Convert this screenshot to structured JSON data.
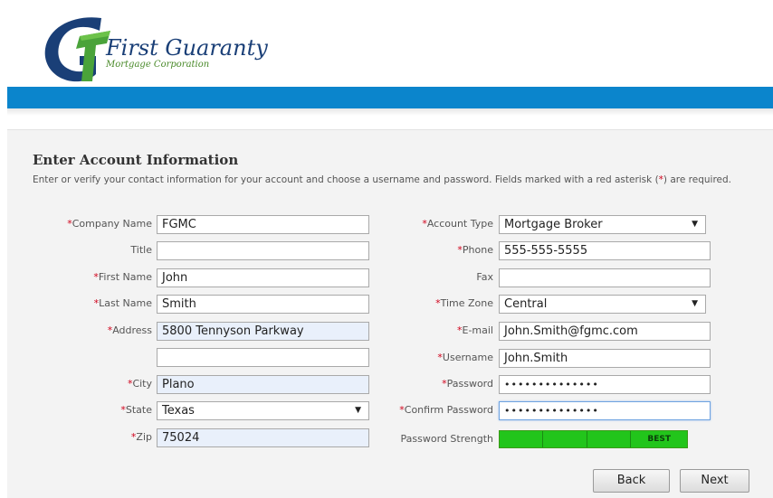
{
  "brand": {
    "name": "First Guaranty",
    "subtitle": "Mortgage Corporation",
    "colors": {
      "navy": "#1a3f77",
      "green": "#4a8a2a",
      "bar": "#0b85cc"
    }
  },
  "form": {
    "title": "Enter Account Information",
    "description_before": "Enter or verify your contact information for your account and choose a username and password. Fields marked with a red asterisk (",
    "description_asterisk": "*",
    "description_after": ") are required.",
    "left": [
      {
        "label": "Company Name",
        "value": "FGMC",
        "required": true
      },
      {
        "label": "Title",
        "value": "",
        "required": false
      },
      {
        "label": "First Name",
        "value": "John",
        "required": true
      },
      {
        "label": "Last Name",
        "value": "Smith",
        "required": true
      },
      {
        "label": "Address",
        "value": "5800 Tennyson Parkway",
        "required": true
      },
      {
        "label": "",
        "value": "",
        "required": false
      },
      {
        "label": "City",
        "value": "Plano",
        "required": true
      },
      {
        "label": "State",
        "value": "Texas",
        "required": true
      },
      {
        "label": "Zip",
        "value": "75024",
        "required": true
      }
    ],
    "right": [
      {
        "label": "Account Type",
        "value": "Mortgage Broker",
        "required": true
      },
      {
        "label": "Phone",
        "value": "555-555-5555",
        "required": true
      },
      {
        "label": "Fax",
        "value": "",
        "required": false
      },
      {
        "label": "Time Zone",
        "value": "Central",
        "required": true
      },
      {
        "label": "E-mail",
        "value": "John.Smith@fgmc.com",
        "required": true
      },
      {
        "label": "Username",
        "value": "John.Smith",
        "required": true
      },
      {
        "label": "Password",
        "value": "••••••••••••••",
        "required": true
      },
      {
        "label": "Confirm Password",
        "value": "••••••••••••••",
        "required": true
      }
    ],
    "password_strength": {
      "label": "Password Strength",
      "level_text": "BEST"
    },
    "required_marker": "*",
    "buttons": {
      "back": "Back",
      "next": "Next"
    }
  }
}
